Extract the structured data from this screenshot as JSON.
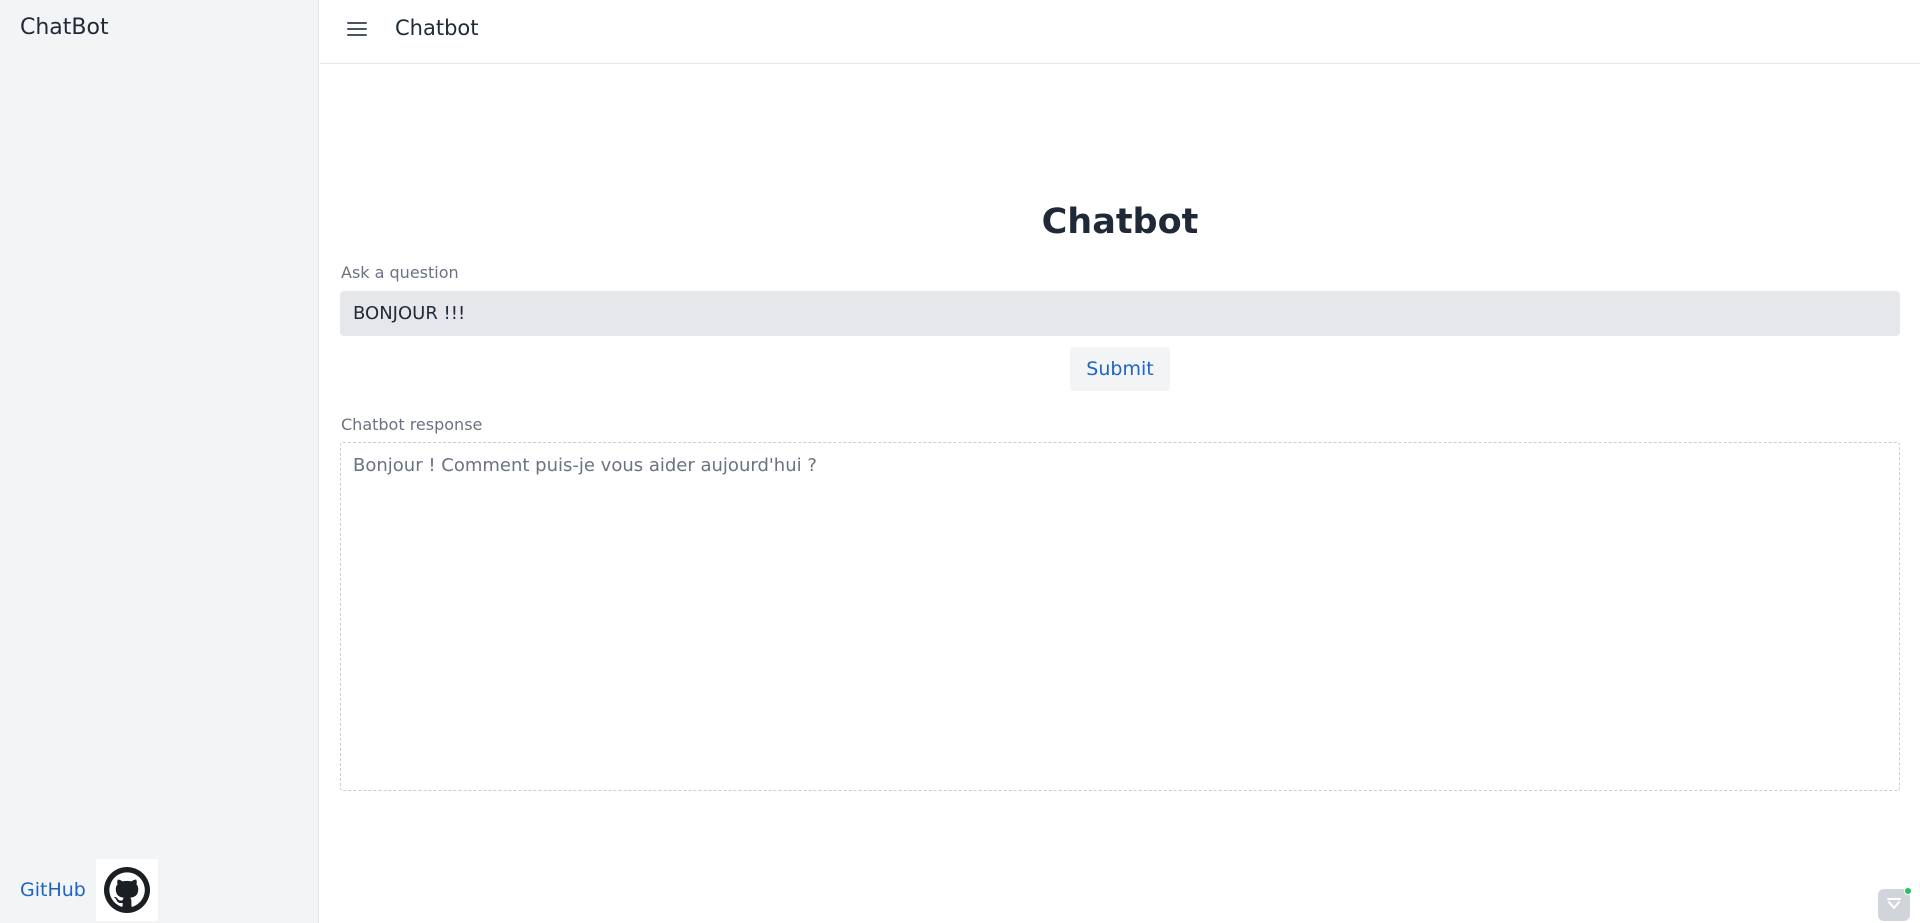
{
  "sidebar": {
    "brand": "ChatBot",
    "footer": {
      "github_label": "GitHub",
      "github_icon": "github-icon"
    }
  },
  "topbar": {
    "menu_icon": "hamburger-icon",
    "title": "Chatbot"
  },
  "main": {
    "page_title": "Chatbot",
    "question": {
      "label": "Ask a question",
      "value": "BONJOUR !!!"
    },
    "submit_label": "Submit",
    "response": {
      "label": "Chatbot response",
      "value": "Bonjour ! Comment puis-je vous aider aujourd'hui ?"
    }
  },
  "widget": {
    "icon": "chevron-down-icon"
  },
  "colors": {
    "accent": "#1d64c4",
    "sidebar_bg": "#f3f4f6",
    "input_bg": "#e5e7eb",
    "status_dot": "#22c55e"
  }
}
